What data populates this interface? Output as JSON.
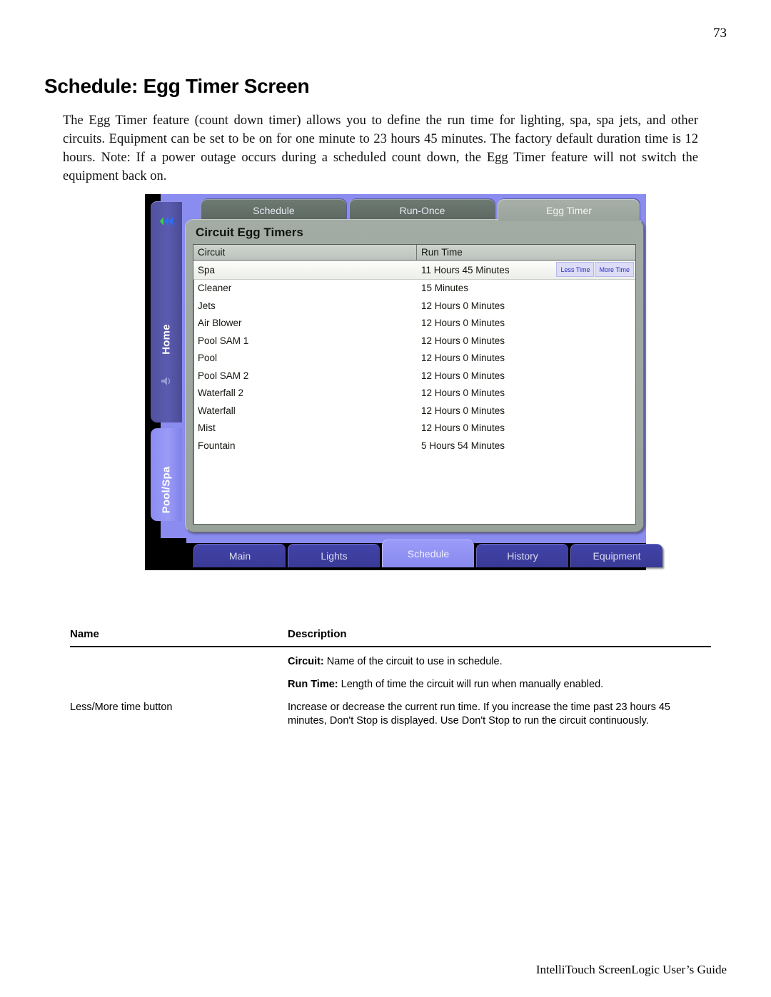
{
  "page": {
    "number": "73",
    "title": "Schedule: Egg Timer Screen",
    "intro": "The Egg Timer feature (count down timer) allows you to define the run time for lighting, spa, spa jets, and other circuits. Equipment can be set to be on for one minute to 23 hours 45 minutes. The factory default duration time is 12 hours. Note: If a power outage occurs during a scheduled count down, the Egg Timer feature will not switch the equipment back on.",
    "footer": "IntelliTouch ScreenLogic User’s Guide"
  },
  "screenshot": {
    "side_rail": {
      "home_label": "Home",
      "poolspa_label": "Pool/Spa",
      "home_icon": "arrow-right-diamond-icon",
      "poolspa_icon": "speaker-icon"
    },
    "tabs": [
      {
        "label": "Schedule",
        "active": false
      },
      {
        "label": "Run-Once",
        "active": false
      },
      {
        "label": "Egg Timer",
        "active": true
      }
    ],
    "panel": {
      "heading": "Circuit Egg Timers",
      "columns": [
        "Circuit",
        "Run Time"
      ],
      "rows": [
        {
          "circuit": "Spa",
          "runtime": "11 Hours 45 Minutes",
          "selected": true
        },
        {
          "circuit": "Cleaner",
          "runtime": "15 Minutes",
          "selected": false
        },
        {
          "circuit": "Jets",
          "runtime": "12 Hours 0 Minutes",
          "selected": false
        },
        {
          "circuit": "Air Blower",
          "runtime": "12 Hours 0 Minutes",
          "selected": false
        },
        {
          "circuit": "Pool SAM 1",
          "runtime": "12 Hours 0 Minutes",
          "selected": false
        },
        {
          "circuit": "Pool",
          "runtime": "12 Hours 0 Minutes",
          "selected": false
        },
        {
          "circuit": "Pool SAM 2",
          "runtime": "12 Hours 0 Minutes",
          "selected": false
        },
        {
          "circuit": "Waterfall 2",
          "runtime": "12 Hours 0 Minutes",
          "selected": false
        },
        {
          "circuit": "Waterfall",
          "runtime": "12 Hours 0 Minutes",
          "selected": false
        },
        {
          "circuit": "Mist",
          "runtime": "12 Hours 0 Minutes",
          "selected": false
        },
        {
          "circuit": "Fountain",
          "runtime": "5 Hours 54 Minutes",
          "selected": false
        }
      ],
      "less_time_label": "Less Time",
      "more_time_label": "More Time"
    },
    "bottom_nav": [
      {
        "label": "Main",
        "active": false
      },
      {
        "label": "Lights",
        "active": false
      },
      {
        "label": "Schedule",
        "active": true
      },
      {
        "label": "History",
        "active": false
      },
      {
        "label": "Equipment",
        "active": false
      }
    ],
    "colors": {
      "chassis_purple": "#8b8cf0",
      "panel_grey": "#a3aca4",
      "tab_inactive": "#5b6760",
      "nav_inactive": "#3f40a0",
      "nav_active": "#9a9bf8",
      "time_button_text": "#2b2bc6",
      "time_button_bg": "#dcdcf6"
    }
  },
  "description_table": {
    "headers": {
      "name": "Name",
      "description": "Description"
    },
    "rows": [
      {
        "name": "",
        "desc_bold": "Circuit:",
        "desc_text": " Name of the circuit to use in schedule."
      },
      {
        "name": "",
        "desc_bold": "Run Time:",
        "desc_text": " Length of time the circuit will run when manually enabled."
      },
      {
        "name": "Less/More time button",
        "desc_bold": "",
        "desc_text": "Increase or decrease the current run time. If you increase the time past 23 hours 45 minutes,  Don't  Stop is displayed. Use Don't Stop to run the circuit continuously."
      }
    ]
  }
}
